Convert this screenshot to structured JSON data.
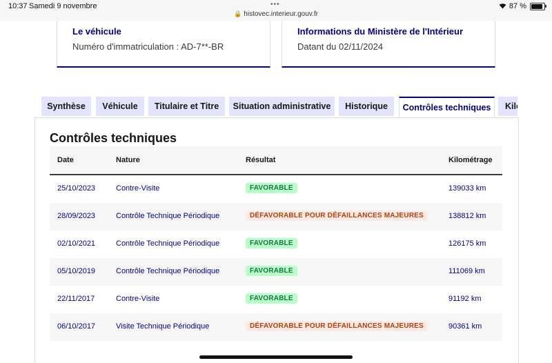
{
  "statusbar": {
    "time": "10:37",
    "date": "Samedi 9 novembre",
    "url": "histovec.interieur.gouv.fr",
    "battery": "87 %",
    "battery_level_percent": 87
  },
  "cards": [
    {
      "title": "Le véhicule",
      "text": "Numéro d'immatriculation : AD-7**-BR"
    },
    {
      "title": "Informations du Ministère de l'Intérieur",
      "text": "Datant du 02/11/2024"
    }
  ],
  "tabs": [
    {
      "label": "Synthèse"
    },
    {
      "label": "Véhicule"
    },
    {
      "label": "Titulaire et Titre"
    },
    {
      "label": "Situation administrative"
    },
    {
      "label": "Historique"
    },
    {
      "label": "Contrôles techniques"
    },
    {
      "label": "Kilo"
    }
  ],
  "section": {
    "title": "Contrôles techniques",
    "columns": [
      "Date",
      "Nature",
      "Résultat",
      "Kilométrage"
    ],
    "rows": [
      {
        "date": "25/10/2023",
        "nature": "Contre-Visite",
        "result": "FAVORABLE",
        "status": "ok",
        "km": "139033 km"
      },
      {
        "date": "28/09/2023",
        "nature": "Contrôle Technique Périodique",
        "result": "DÉFAVORABLE POUR DÉFAILLANCES MAJEURES",
        "status": "ko",
        "km": "138812 km"
      },
      {
        "date": "02/10/2021",
        "nature": "Contrôle Technique Périodique",
        "result": "FAVORABLE",
        "status": "ok",
        "km": "126175 km"
      },
      {
        "date": "05/10/2019",
        "nature": "Contrôle Technique Périodique",
        "result": "FAVORABLE",
        "status": "ok",
        "km": "111069 km"
      },
      {
        "date": "22/11/2017",
        "nature": "Contre-Visite",
        "result": "FAVORABLE",
        "status": "ok",
        "km": "91192 km"
      },
      {
        "date": "06/10/2017",
        "nature": "Visite Technique Périodique",
        "result": "DÉFAVORABLE POUR DÉFAILLANCES MAJEURES",
        "status": "ko",
        "km": "90361 km"
      }
    ]
  },
  "colors": {
    "primary": "#000091",
    "tab_background": "#e3e3fd",
    "success_bg": "#b8fec9",
    "success_text": "#18753c",
    "error_bg": "#ffe9e6",
    "error_text": "#b34000"
  }
}
